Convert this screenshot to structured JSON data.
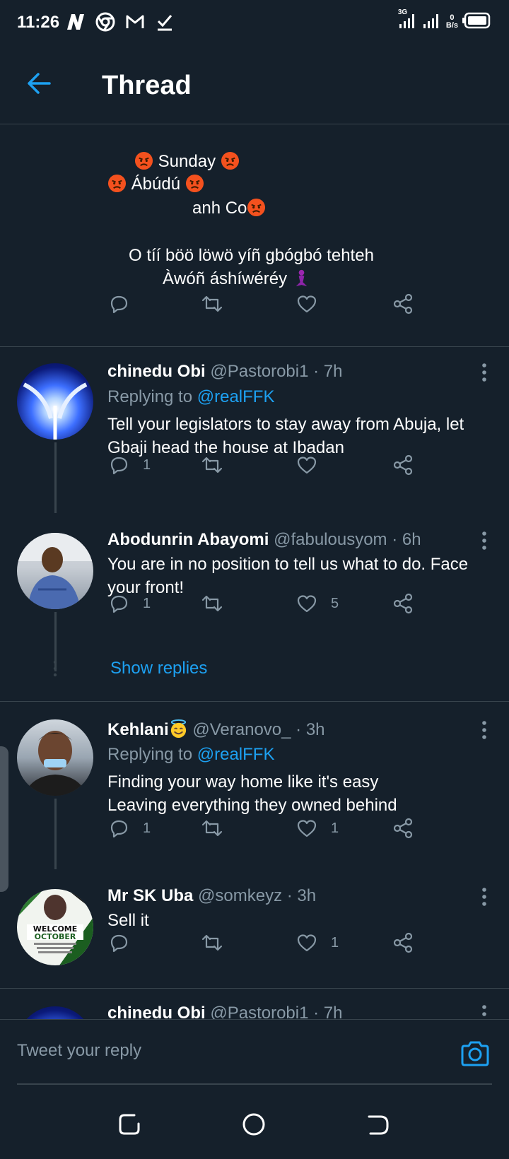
{
  "status_bar": {
    "time": "11:26",
    "network_label": "3G",
    "speed_value": "0",
    "speed_unit": "B/s"
  },
  "header": {
    "title": "Thread"
  },
  "main_tweet": {
    "lines": [
      "Sunday",
      "Ábúdú",
      "anh  Co",
      "O  tíí  böö  löwö  yíñ gbógbó tehteh",
      "Àwóñ  áshíwéréy"
    ],
    "emojis": [
      "angry-face",
      "mermaid"
    ]
  },
  "colors": {
    "background": "#15202b",
    "accent": "#1da1f2",
    "secondary_text": "#8899a6",
    "divider": "#38444d"
  },
  "replies": [
    {
      "name": "chinedu Obi",
      "handle": "@Pastorobi1",
      "time": "· 7h",
      "replying_label": "Replying to",
      "replying_handle": "@realFFK",
      "text": "Tell your legislators to stay away from Abuja, let Gbaji head the house at Ibadan",
      "reply_count": "1",
      "retweet_count": "",
      "like_count": ""
    },
    {
      "name": "Abodunrin Abayomi",
      "handle": "@fabulousyom",
      "time": "· 6h",
      "text": "You are in no position to tell us what to do. Face your front!",
      "reply_count": "1",
      "retweet_count": "",
      "like_count": "5",
      "show_replies": "Show replies"
    },
    {
      "name": "Kehlani",
      "name_emoji": "smiling-face-with-halo",
      "handle": "@Veranovo_",
      "time": "· 3h",
      "replying_label": "Replying to",
      "replying_handle": "@realFFK",
      "text_line1": "Finding your way home like it's easy",
      "text_line2": "Leaving everything they owned behind",
      "reply_count": "1",
      "retweet_count": "",
      "like_count": "1"
    },
    {
      "name": "Mr SK Uba",
      "handle": "@somkeyz",
      "time": "· 3h",
      "text": "Sell it",
      "reply_count": "",
      "retweet_count": "",
      "like_count": "1",
      "avatar_text_1": "WELCOME",
      "avatar_text_2": "OCTOBER"
    },
    {
      "name": "chinedu Obi",
      "handle": "@Pastorobi1",
      "time": "· 7h"
    }
  ],
  "reply_bar": {
    "placeholder": "Tweet your reply"
  }
}
